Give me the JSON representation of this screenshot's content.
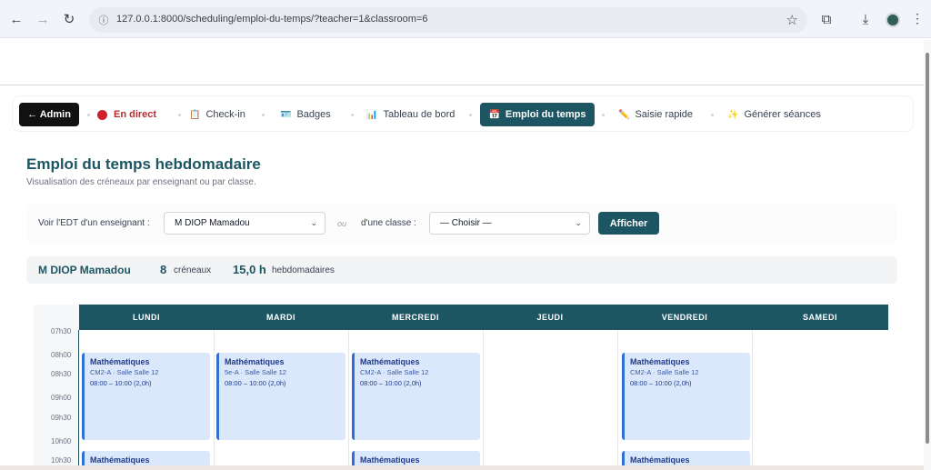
{
  "browser": {
    "url": "127.0.0.1:8000/scheduling/emploi-du-temps/?teacher=1&classroom=6"
  },
  "nav": {
    "admin": "← Admin",
    "live": "En direct",
    "checkin": "Check-in",
    "badges": "Badges",
    "dashboard": "Tableau de bord",
    "timetable": "Emploi du temps",
    "quick_entry": "Saisie rapide",
    "generate": "Générer séances",
    "icons": {
      "checkin": "clipboard-icon",
      "badges": "id-card-icon",
      "dashboard": "bar-chart-icon",
      "timetable": "calendar-icon",
      "quick_entry": "pencil-icon",
      "generate": "sparkles-icon"
    }
  },
  "page": {
    "title": "Emploi du temps hebdomadaire",
    "subtitle": "Visualisation des créneaux par enseignant ou par classe."
  },
  "filters": {
    "teacher_label": "Voir l'EDT d'un enseignant :",
    "teacher_value": "M DIOP Mamadou",
    "or_label": "ou",
    "class_label": "d'une classe :",
    "class_value": "— Choisir —",
    "submit": "Afficher"
  },
  "summary": {
    "name": "M DIOP Mamadou",
    "slots_count": "8",
    "slots_label": "créneaux",
    "hours": "15,0 h",
    "hours_label": "hebdomadaires"
  },
  "timetable": {
    "days": [
      "LUNDI",
      "MARDI",
      "MERCREDI",
      "JEUDI",
      "VENDREDI",
      "SAMEDI"
    ],
    "times": [
      "07h30",
      "08h00",
      "08h30",
      "09h00",
      "09h30",
      "10h00",
      "10h30"
    ],
    "events": [
      {
        "title": "Mathématiques",
        "sub": "CM2-A · Salle Salle 12",
        "time": "08:00 – 10:00 (2,0h)"
      },
      {
        "title": "Mathématiques",
        "sub": "5e-A · Salle Salle 12",
        "time": "08:00 – 10:00 (2,0h)"
      },
      {
        "title": "Mathématiques",
        "sub": "CM2-A · Salle Salle 12",
        "time": "08:00 – 10:00 (2,0h)"
      },
      {
        "title": "Mathématiques",
        "sub": "CM2-A · Salle Salle 12",
        "time": "08:00 – 10:00 (2,0h)"
      },
      {
        "title": "Mathématiques"
      },
      {
        "title": "Mathématiques"
      },
      {
        "title": "Mathématiques"
      }
    ],
    "accent_color": "#1d5563",
    "event_color": "#dbe7fb"
  }
}
